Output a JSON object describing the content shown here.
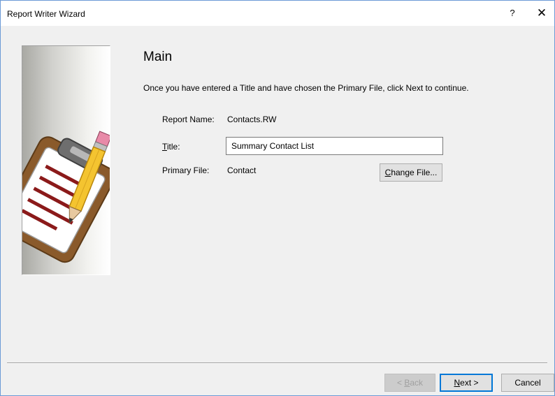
{
  "window": {
    "title": "Report Writer Wizard",
    "help_label": "?",
    "close_label": "✕"
  },
  "page": {
    "heading": "Main",
    "instruction": "Once you have entered a Title and have chosen the Primary File, click Next to continue."
  },
  "form": {
    "report_name_label": "Report Name:",
    "report_name_value": "Contacts.RW",
    "title_label_mnemonic": "T",
    "title_label_rest": "itle:",
    "title_value": "Summary Contact List",
    "primary_file_label": "Primary File:",
    "primary_file_value": "Contact",
    "change_file_mnemonic": "C",
    "change_file_rest": "hange File..."
  },
  "buttons": {
    "back_prefix": "< ",
    "back_mnemonic": "B",
    "back_rest": "ack",
    "back_enabled": false,
    "next_mnemonic": "N",
    "next_rest": "ext >",
    "cancel_label": "Cancel"
  },
  "colors": {
    "accent": "#0078d7",
    "window_border": "#6b9ad6",
    "dialog_bg": "#f0f0f0",
    "clipboard_brown": "#8a5a2b",
    "line_red": "#8b1a1a",
    "pencil_yellow": "#f4c430"
  },
  "icons": {
    "wizard_image": "clipboard-with-pencil-icon",
    "close": "close-icon",
    "help": "help-icon"
  }
}
